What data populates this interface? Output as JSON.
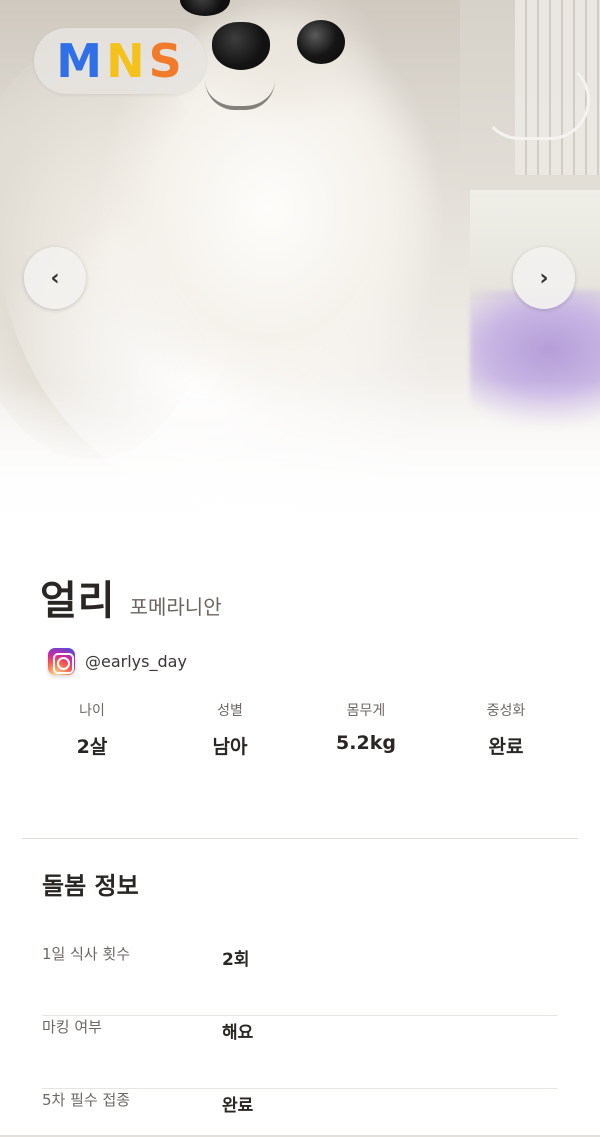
{
  "brand": {
    "logo_letters": [
      "M",
      "N",
      "S"
    ],
    "logo_colors": [
      "#2f6fe8",
      "#f5c21b",
      "#f27a2b"
    ]
  },
  "carousel": {
    "prev_label": "‹",
    "next_label": "›"
  },
  "pet": {
    "name": "얼리",
    "breed": "포메라니안",
    "instagram": "@earlys_day",
    "stats": [
      {
        "label": "나이",
        "value": "2살"
      },
      {
        "label": "성별",
        "value": "남아"
      },
      {
        "label": "몸무게",
        "value": "5.2kg"
      },
      {
        "label": "중성화",
        "value": "완료"
      }
    ]
  },
  "care": {
    "title": "돌봄 정보",
    "rows": [
      {
        "label": "1일 식사 횟수",
        "value": "2회"
      },
      {
        "label": "마킹 여부",
        "value": "해요"
      },
      {
        "label": "5차 필수 접종",
        "value": "완료"
      }
    ]
  }
}
